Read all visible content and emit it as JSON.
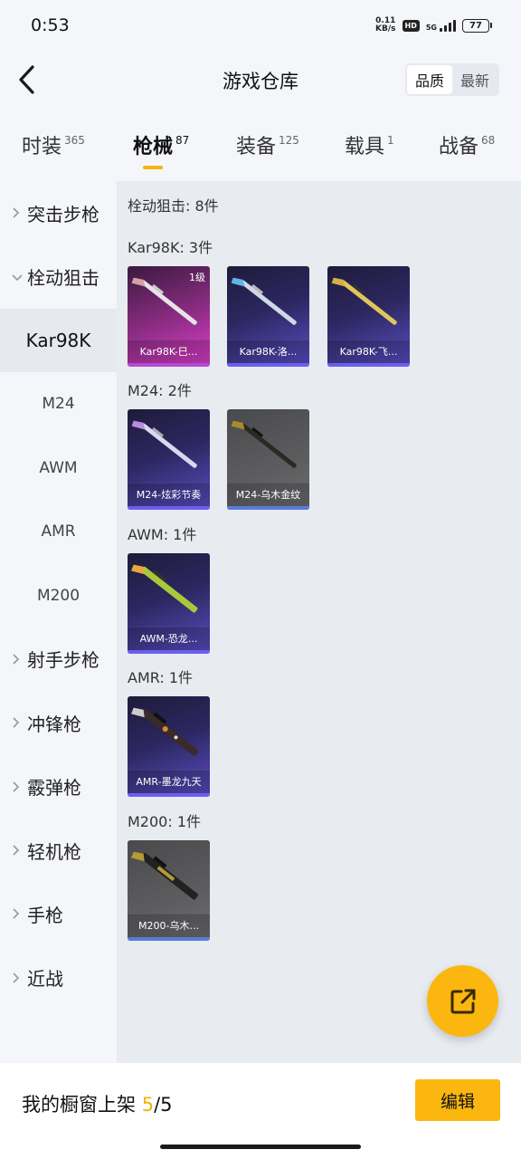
{
  "status_bar": {
    "time": "0:53",
    "net_speed_value": "0.11",
    "net_speed_unit": "KB/s",
    "hd_badge": "HD",
    "signal_label": "5G",
    "battery": "77"
  },
  "header": {
    "title": "游戏仓库",
    "sort_options": [
      "品质",
      "最新"
    ],
    "sort_selected": "品质"
  },
  "tabs": [
    {
      "label": "时装",
      "count": "365"
    },
    {
      "label": "枪械",
      "count": "87",
      "active": true
    },
    {
      "label": "装备",
      "count": "125"
    },
    {
      "label": "载具",
      "count": "1"
    },
    {
      "label": "战备",
      "count": "68"
    }
  ],
  "sidebar": {
    "items": [
      {
        "label": "突击步枪",
        "type": "group",
        "expanded": false
      },
      {
        "label": "栓动狙击",
        "type": "group",
        "expanded": true
      },
      {
        "label": "Kar98K",
        "type": "sub",
        "selected": true
      },
      {
        "label": "M24",
        "type": "sub"
      },
      {
        "label": "AWM",
        "type": "sub"
      },
      {
        "label": "AMR",
        "type": "sub"
      },
      {
        "label": "M200",
        "type": "sub"
      },
      {
        "label": "射手步枪",
        "type": "group",
        "expanded": false
      },
      {
        "label": "冲锋枪",
        "type": "group",
        "expanded": false
      },
      {
        "label": "霰弹枪",
        "type": "group",
        "expanded": false
      },
      {
        "label": "轻机枪",
        "type": "group",
        "expanded": false
      },
      {
        "label": "手枪",
        "type": "group",
        "expanded": false
      },
      {
        "label": "近战",
        "type": "group",
        "expanded": false
      }
    ]
  },
  "main": {
    "title": "栓动狙击: 8件",
    "groups": [
      {
        "title": "Kar98K: 3件",
        "items": [
          {
            "name": "Kar98K-巳...",
            "rarity": "pink",
            "level": "1级"
          },
          {
            "name": "Kar98K-洛...",
            "rarity": "purple"
          },
          {
            "name": "Kar98K-飞...",
            "rarity": "purple"
          }
        ]
      },
      {
        "title": "M24: 2件",
        "items": [
          {
            "name": "M24-炫彩节奏",
            "rarity": "purple"
          },
          {
            "name": "M24-乌木金纹",
            "rarity": "gray"
          }
        ]
      },
      {
        "title": "AWM: 1件",
        "items": [
          {
            "name": "AWM-恐龙...",
            "rarity": "purple"
          }
        ]
      },
      {
        "title": "AMR: 1件",
        "items": [
          {
            "name": "AMR-墨龙九天",
            "rarity": "purple"
          }
        ]
      },
      {
        "title": "M200: 1件",
        "items": [
          {
            "name": "M200-乌木...",
            "rarity": "gray"
          }
        ]
      }
    ]
  },
  "fab": {
    "icon": "share-external-icon"
  },
  "bottom": {
    "showcase_label": "我的橱窗上架",
    "showcase_current": "5",
    "showcase_total": "/5",
    "edit_label": "编辑"
  },
  "colors": {
    "accent": "#fbb70f",
    "tab_underline": "#f5b50a"
  }
}
